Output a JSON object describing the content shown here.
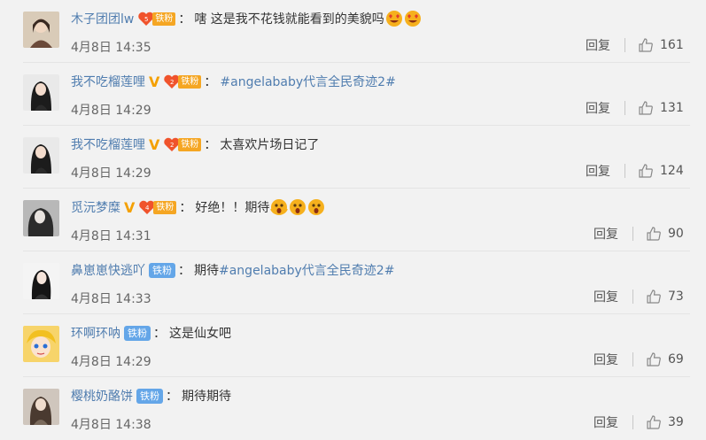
{
  "reply_label": "回复",
  "colors": {
    "link": "#507daf",
    "gold_badge": "#f5a623",
    "blue_badge": "#64a6e8",
    "v_badge": "#f4a000"
  },
  "comments": [
    {
      "user": "木子团团lw",
      "verified": false,
      "fan_level": "5",
      "fan_label": "铁粉",
      "fan_type": "gold",
      "text": "嗐 这是我不花钱就能看到的美貌吗",
      "topic": "",
      "text_after": "",
      "emojis": [
        "heart-eyes-emoji",
        "heart-eyes-emoji"
      ],
      "time": "4月8日 14:35",
      "likes": "161"
    },
    {
      "user": "我不吃榴莲哩",
      "verified": true,
      "fan_level": "2",
      "fan_label": "铁粉",
      "fan_type": "gold",
      "text": "",
      "topic": "#angelababy代言全民奇迹2#",
      "text_after": "",
      "emojis": [],
      "time": "4月8日 14:29",
      "likes": "131"
    },
    {
      "user": "我不吃榴莲哩",
      "verified": true,
      "fan_level": "2",
      "fan_label": "铁粉",
      "fan_type": "gold",
      "text": "太喜欢片场日记了",
      "topic": "",
      "text_after": "",
      "emojis": [],
      "time": "4月8日 14:29",
      "likes": "124"
    },
    {
      "user": "觅沅梦糜",
      "verified": true,
      "fan_level": "4",
      "fan_label": "铁粉",
      "fan_type": "gold",
      "text": "好绝！！期待",
      "topic": "",
      "text_after": "",
      "emojis": [
        "shocked-emoji",
        "shocked-emoji",
        "shocked-emoji"
      ],
      "time": "4月8日 14:31",
      "likes": "90"
    },
    {
      "user": "鼻崽崽快逃吖",
      "verified": false,
      "fan_level": "",
      "fan_label": "铁粉",
      "fan_type": "blue",
      "text": "期待",
      "topic": "#angelababy代言全民奇迹2#",
      "text_after": "",
      "emojis": [],
      "time": "4月8日 14:33",
      "likes": "73"
    },
    {
      "user": "环啊环呐",
      "verified": false,
      "fan_level": "",
      "fan_label": "铁粉",
      "fan_type": "blue",
      "text": "这是仙女吧",
      "topic": "",
      "text_after": "",
      "emojis": [],
      "time": "4月8日 14:29",
      "likes": "69"
    },
    {
      "user": "樱桃奶酪饼",
      "verified": false,
      "fan_level": "",
      "fan_label": "铁粉",
      "fan_type": "blue",
      "text": "期待期待",
      "topic": "",
      "text_after": "",
      "emojis": [],
      "time": "4月8日 14:38",
      "likes": "39"
    }
  ]
}
